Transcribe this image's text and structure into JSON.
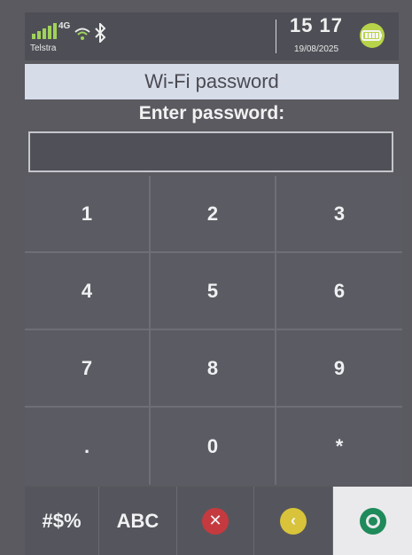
{
  "status": {
    "network": "4G",
    "carrier": "Telstra",
    "time": "15 17",
    "date": "19/08/2025"
  },
  "title": "Wi-Fi password",
  "prompt": "Enter password:",
  "password_value": "",
  "keypad": {
    "keys": [
      "1",
      "2",
      "3",
      "4",
      "5",
      "6",
      "7",
      "8",
      "9",
      ".",
      "0",
      "*"
    ]
  },
  "bottom_row": {
    "symbols_label": "#$%",
    "alpha_label": "ABC",
    "cancel_icon": "cancel-icon",
    "back_icon": "back-icon",
    "confirm_icon": "confirm-icon"
  },
  "colors": {
    "cancel": "#c43a3f",
    "back": "#d8c33a",
    "confirm": "#1f8a5a",
    "battery": "#b7d34a"
  }
}
